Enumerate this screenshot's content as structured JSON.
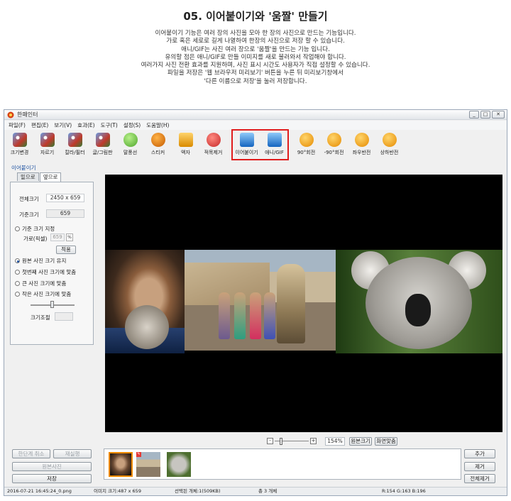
{
  "doc": {
    "title": "05. 이어붙이기와 '움짤' 만들기",
    "lines": [
      "이어붙이기 기능은 여러 장의 사진을 모아 한 장의 사진으로 만드는 기능입니다.",
      "가로 혹은 세로로 길게 나열하여 한장의 사진으로 저장 할 수 있습니다.",
      "애니/GIF는 사진 여러 장으로 '움짤'을 만드는 기능 입니다.",
      "유의할 점은 애니/GIF로 만들 이미지를 새로 불러와서 작업해야 합니다.",
      "여러가지 사진 전환 효과를 지원하며, 사진 표시 시간도 사용자가 직접 설정할 수 있습니다.",
      "파일을 저장은 '웹 브라우저 미리보기' 버튼을 누른 뒤 미리보기창에서",
      "'다른 이름으로 저장'을 눌러 저장합니다."
    ]
  },
  "window": {
    "title": "photoscape-style app",
    "title_text": "한패인터",
    "buttons": [
      "_",
      "□",
      "✕"
    ]
  },
  "menu": [
    "파일(F)",
    "편집(E)",
    "보기(V)",
    "효과(E)",
    "도구(T)",
    "설정(S)",
    "도움말(H)"
  ],
  "toolbar": [
    {
      "label": "크기변경",
      "icon": "resize-icon"
    },
    {
      "label": "자르기",
      "icon": "crop-icon"
    },
    {
      "label": "칼라/필터",
      "icon": "color-filter-icon"
    },
    {
      "label": "글/그림판",
      "icon": "text-draw-icon"
    },
    {
      "label": "말풍선",
      "icon": "speech-balloon-icon"
    },
    {
      "label": "스티커",
      "icon": "sticker-icon"
    },
    {
      "label": "액자",
      "icon": "frame-icon"
    },
    {
      "label": "적목제거",
      "icon": "red-eye-icon"
    },
    {
      "label": "이어붙이기",
      "icon": "combine-icon"
    },
    {
      "label": "애니/GIF",
      "icon": "gif-icon"
    },
    {
      "label": "90°회전",
      "icon": "rotate-cw-icon"
    },
    {
      "label": "-90°회전",
      "icon": "rotate-ccw-icon"
    },
    {
      "label": "좌우반전",
      "icon": "flip-horizontal-icon"
    },
    {
      "label": "상하반전",
      "icon": "flip-vertical-icon"
    }
  ],
  "panel": {
    "label": "이어붙이기",
    "tabs": [
      "밑으로",
      "옆으로"
    ],
    "total_size_label": "전체크기",
    "total_size_value": "2450 x 659",
    "base_size_label": "기준크기",
    "base_size_value": "659",
    "opt_base": "기준 크기 지정",
    "width_label": "가로(픽셀)",
    "width_value": "659",
    "percent_sign": "%",
    "apply": "적용",
    "opt_keep": "원본 사진 크기 유지",
    "opt_first": "첫번째 사진 크기에 맞춤",
    "opt_large": "큰 사진 크기에 맞춤",
    "opt_small": "작은 사진 크기에 맞춤",
    "size_adjust": "크기조절"
  },
  "zoom": {
    "minus": "-",
    "plus": "+",
    "value": "154%",
    "original": "원본크기",
    "fit": "화면맞춤"
  },
  "bottom_left": {
    "undo_step": "한단계 취소",
    "redo": "재실행",
    "original_photo": "원본사진",
    "save": "저장"
  },
  "bottom_right": {
    "add": "추가",
    "remove": "제거",
    "remove_all": "전체제거"
  },
  "status": {
    "file": "2016-07-21 16:45:24_0.png",
    "image_size": "이미지 크기:487 x 659",
    "selected": "선택된 개체:1(509KB)",
    "total": "총 3 개체",
    "rgb": "R:154 G:163 B:196"
  },
  "thumb_badge": "✎"
}
